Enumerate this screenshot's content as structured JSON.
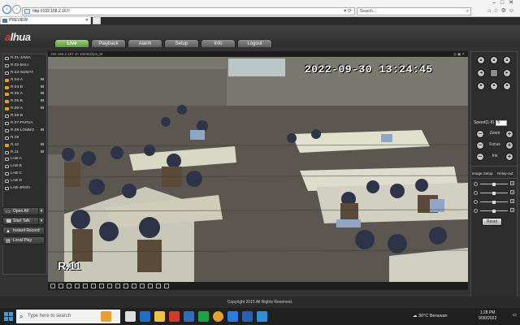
{
  "browser": {
    "url": "http://192.168.2.167/",
    "search_placeholder": "Search...",
    "tab_title": "PREVIEW"
  },
  "app": {
    "logo": "alhua",
    "tabs": [
      "Live",
      "Playback",
      "Alarm",
      "Setup",
      "Info",
      "Logout"
    ],
    "active_tab": "Live",
    "footer": "Copyright 2015 All Rights Reserved."
  },
  "channels": [
    {
      "label": "R.01-JAWA",
      "mark": "",
      "rec": false
    },
    {
      "label": "R.02-BALI",
      "mark": "",
      "rec": false
    },
    {
      "label": "R.03-SUMAT",
      "mark": "",
      "rec": false
    },
    {
      "label": "R.04-A",
      "mark": "M",
      "rec": true
    },
    {
      "label": "R.04-B",
      "mark": "M",
      "rec": true
    },
    {
      "label": "R.05-A",
      "mark": "M",
      "rec": true
    },
    {
      "label": "R.05-B",
      "mark": "M",
      "rec": true
    },
    {
      "label": "R.06-A",
      "mark": "M",
      "rec": true
    },
    {
      "label": "R.06-B",
      "mark": "",
      "rec": false
    },
    {
      "label": "R.07-PAPUA",
      "mark": "",
      "rec": false
    },
    {
      "label": "R.08-LOMBO",
      "mark": "M",
      "rec": false
    },
    {
      "label": "R.09",
      "mark": "",
      "rec": false
    },
    {
      "label": "R.10",
      "mark": "M",
      "rec": true
    },
    {
      "label": "R.11",
      "mark": "M",
      "rec": false
    },
    {
      "label": "LAB-A",
      "mark": "",
      "rec": false
    },
    {
      "label": "LAB-B",
      "mark": "",
      "rec": false
    },
    {
      "label": "LAB-C",
      "mark": "",
      "rec": false
    },
    {
      "label": "LAB-D",
      "mark": "",
      "rec": false
    },
    {
      "label": "LAB-JRGN",
      "mark": "",
      "rec": false
    }
  ],
  "left_buttons": {
    "open_all": "Open All",
    "start_talk": "Start Talk",
    "instant_record": "Instant Record",
    "local_play": "Local Play"
  },
  "video": {
    "title": "192.168.2.167 ch 10040@ps_M",
    "timestamp": "2022-09-30  13:24:45",
    "channel_label": "R.11"
  },
  "ptz": {
    "speed_label": "Speed(1-8)",
    "speed_value": "5",
    "zoom_label": "Zoom",
    "focus_label": "Focus",
    "iris_label": "Iris"
  },
  "image_setup": {
    "tab1": "Image Setup",
    "tab2": "Relay-out",
    "brightness": 0.5,
    "contrast": 0.5,
    "saturation": 0.5,
    "hue": 0.5,
    "reset_label": "Reset"
  },
  "taskbar": {
    "search_text": "Type here to search",
    "weather": "30°C  Berawan",
    "time": "1:28 PM",
    "date": "9/30/2022"
  }
}
